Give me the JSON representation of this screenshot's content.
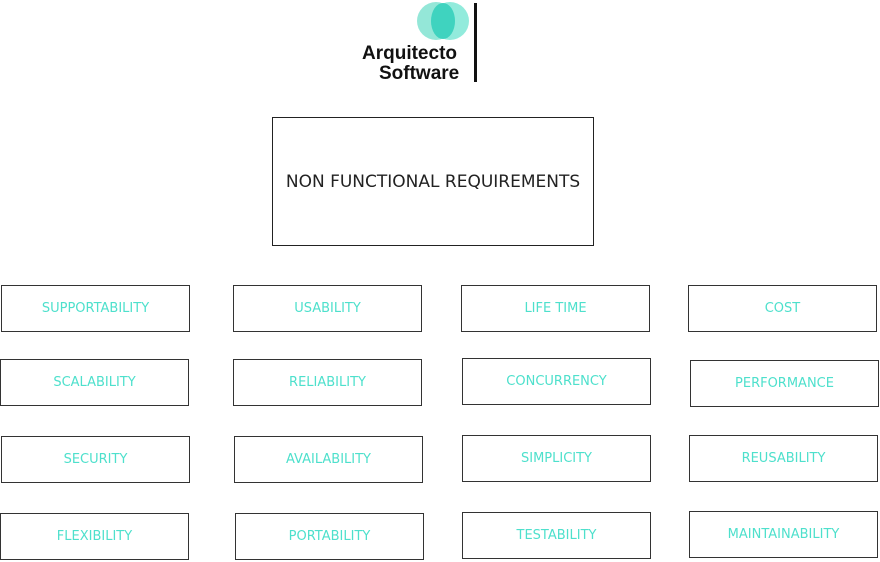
{
  "logo": {
    "line1": "Arquitecto",
    "line2": "Software",
    "accent_color": "#4ee0cc"
  },
  "title": "NON FUNCTIONAL REQUIREMENTS",
  "requirements": [
    "SUPPORTABILITY",
    "USABILITY",
    "LIFE TIME",
    "COST",
    "SCALABILITY",
    "RELIABILITY",
    "CONCURRENCY",
    "PERFORMANCE",
    "SECURITY",
    "AVAILABILITY",
    "SIMPLICITY",
    "REUSABILITY",
    "FLEXIBILITY",
    "PORTABILITY",
    "TESTABILITY",
    "MAINTAINABILITY"
  ]
}
